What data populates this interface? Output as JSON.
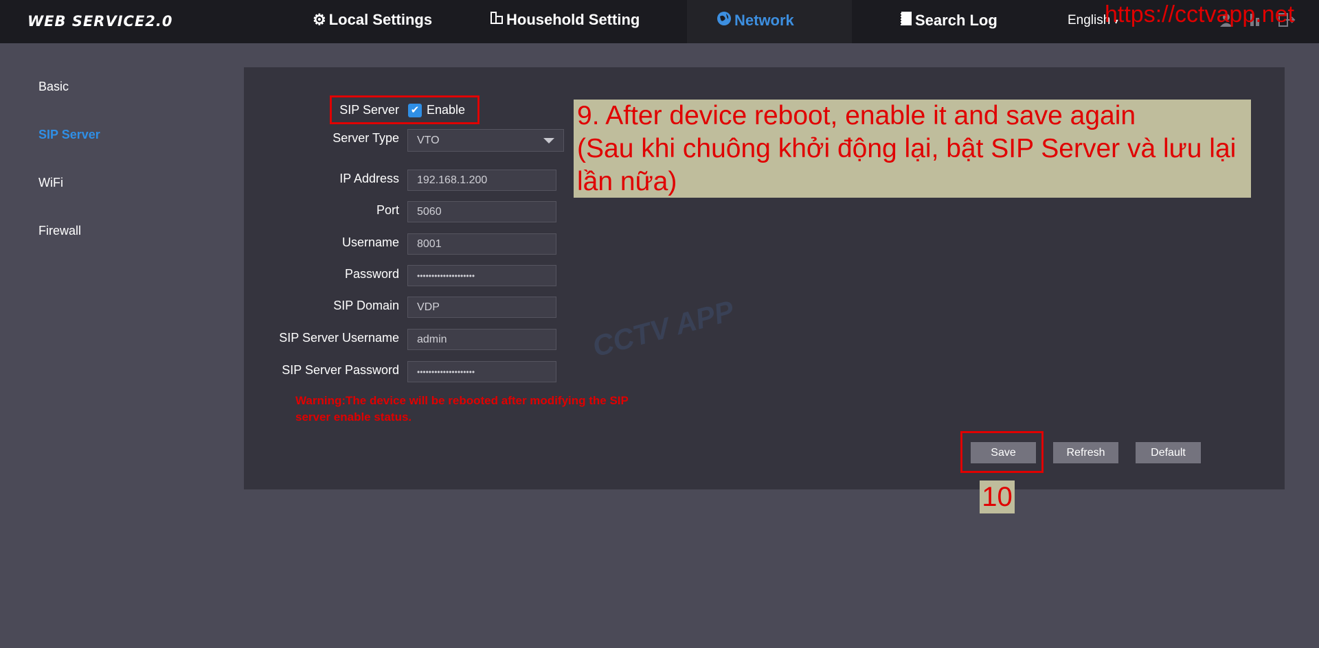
{
  "header": {
    "logo": "WEB SERVICE2.0",
    "nav": [
      {
        "label": "Local Settings",
        "icon": "gear-icon"
      },
      {
        "label": "Household Setting",
        "icon": "building-icon"
      },
      {
        "label": "Network",
        "icon": "globe-icon"
      },
      {
        "label": "Search Log",
        "icon": "document-icon"
      }
    ],
    "language": "English",
    "url_overlay": "https://cctvapp.net"
  },
  "sidebar": {
    "items": [
      {
        "label": "Basic"
      },
      {
        "label": "SIP Server"
      },
      {
        "label": "WiFi"
      },
      {
        "label": "Firewall"
      }
    ]
  },
  "form": {
    "sip_server_label": "SIP Server",
    "enable_label": "Enable",
    "enabled": true,
    "server_type_label": "Server Type",
    "server_type_value": "VTO",
    "ip_label": "IP Address",
    "ip_value": "192.168.1.200",
    "port_label": "Port",
    "port_value": "5060",
    "username_label": "Username",
    "username_value": "8001",
    "password_label": "Password",
    "password_value": "••••••••••••••••••••",
    "domain_label": "SIP Domain",
    "domain_value": "VDP",
    "server_username_label": "SIP Server Username",
    "server_username_value": "admin",
    "server_password_label": "SIP Server Password",
    "server_password_value": "••••••••••••••••••••",
    "warning": "Warning:The device will be rebooted after modifying the SIP server enable status."
  },
  "buttons": {
    "save": "Save",
    "refresh": "Refresh",
    "default": "Default"
  },
  "annotation": {
    "note_line1": "9. After device reboot, enable it and save again",
    "note_line2": "(Sau khi chuông khởi động lại, bật SIP Server và lưu lại lần nữa)",
    "step": "10",
    "watermark": "CCTV APP"
  },
  "colors": {
    "accent": "#2f8fe6",
    "annotation_red": "#e00000",
    "note_bg": "#bfbd9c"
  }
}
